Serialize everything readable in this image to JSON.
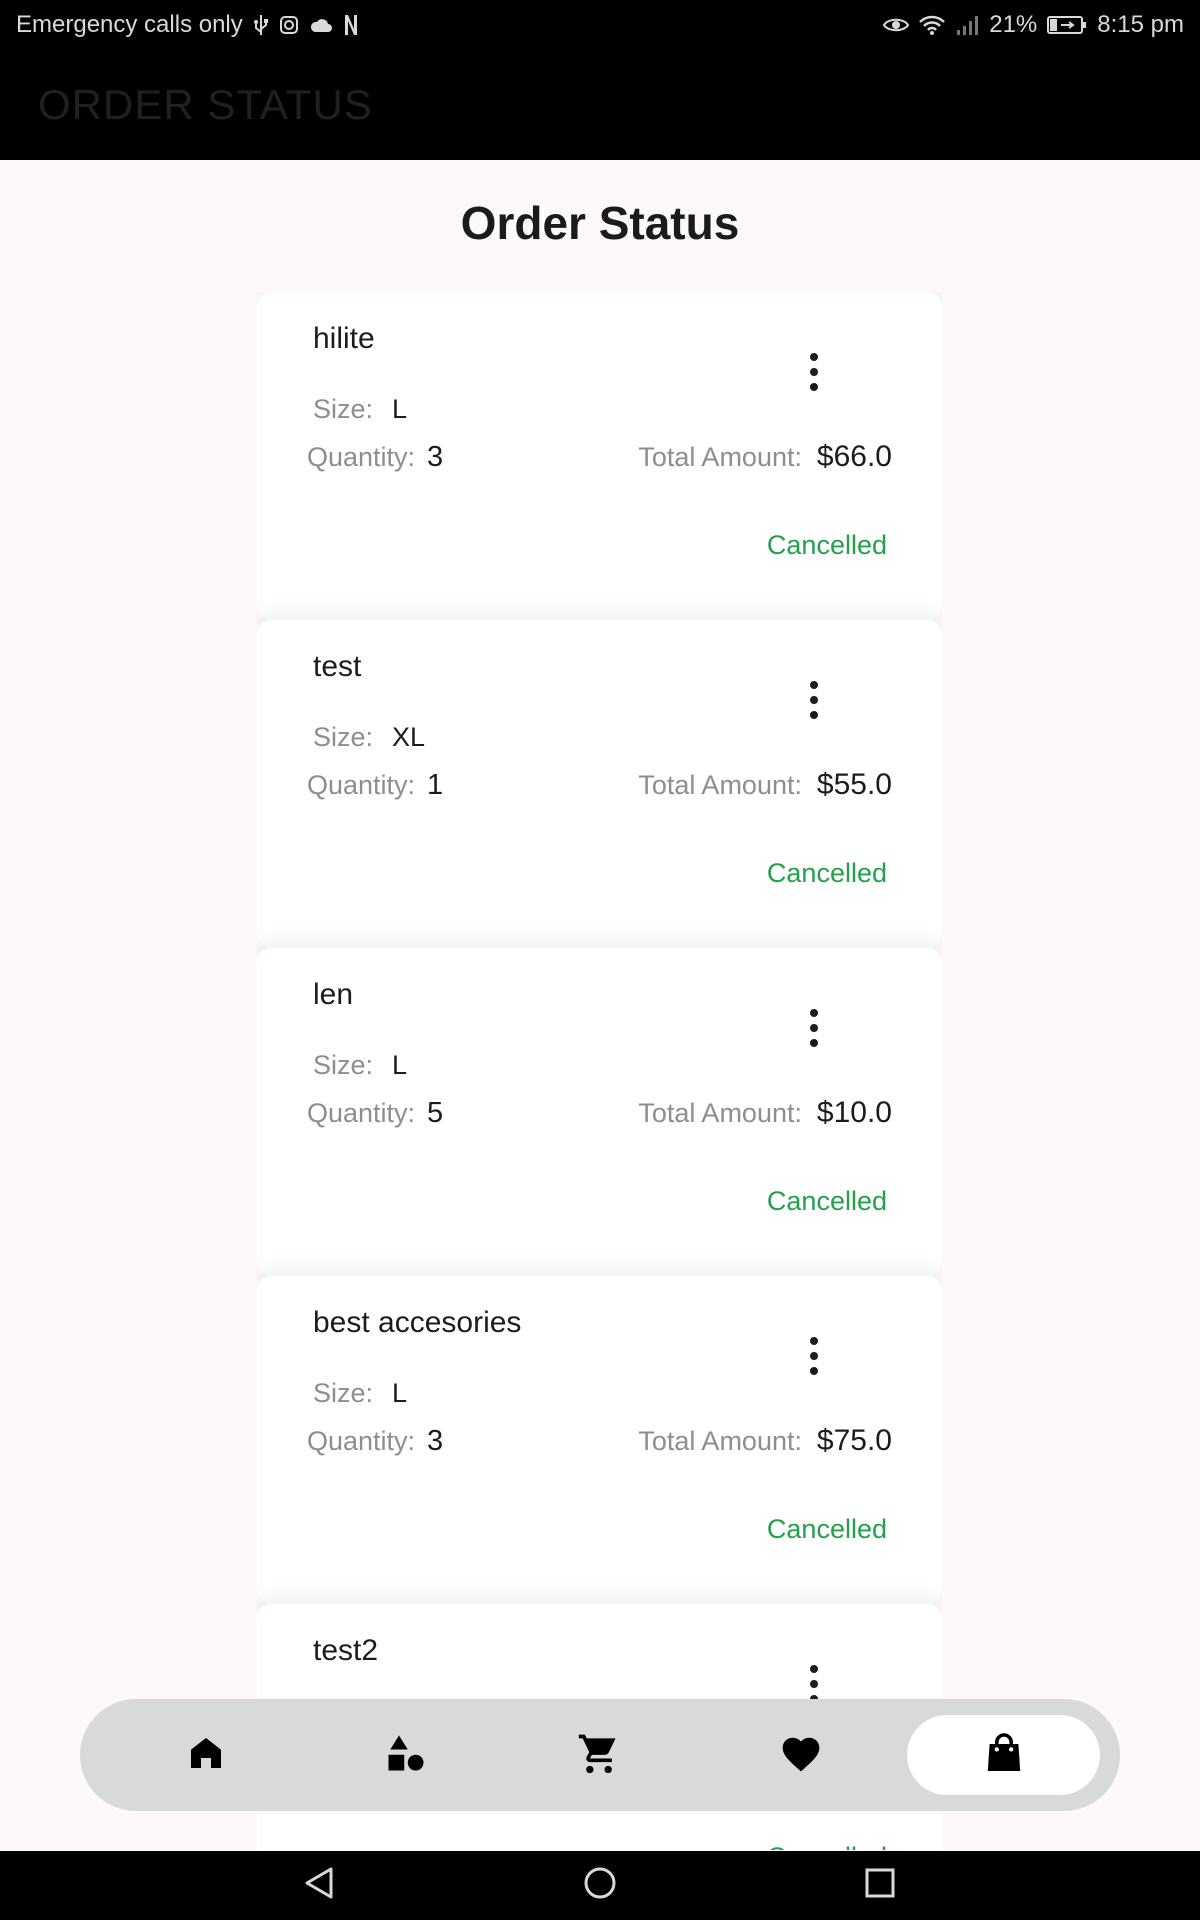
{
  "status_bar": {
    "left_text": "Emergency calls only",
    "battery": "21%",
    "time": "8:15 pm"
  },
  "app_bar": {
    "title": "ORDER STATUS"
  },
  "page": {
    "title": "Order Status"
  },
  "labels": {
    "size": "Size:",
    "quantity": "Quantity:",
    "total_amount": "Total Amount:"
  },
  "orders": [
    {
      "name": "hilite",
      "size": "L",
      "quantity": "3",
      "total": "$66.0",
      "status": "Cancelled"
    },
    {
      "name": "test",
      "size": "XL",
      "quantity": "1",
      "total": "$55.0",
      "status": "Cancelled"
    },
    {
      "name": "len",
      "size": "L",
      "quantity": "5",
      "total": "$10.0",
      "status": "Cancelled"
    },
    {
      "name": "best accesories",
      "size": "L",
      "quantity": "3",
      "total": "$75.0",
      "status": "Cancelled"
    },
    {
      "name": "test2",
      "size": "",
      "quantity": "",
      "total": "",
      "status": "Cancelled"
    }
  ],
  "bottom_nav": {
    "items": [
      {
        "icon": "home-icon"
      },
      {
        "icon": "category-icon"
      },
      {
        "icon": "cart-icon"
      },
      {
        "icon": "heart-icon"
      },
      {
        "icon": "shopping-bag-icon",
        "active": true
      }
    ]
  },
  "colors": {
    "status_cancelled": "#24a04a",
    "nav_background": "#d9d9d9",
    "page_background": "#fcf8fc"
  }
}
